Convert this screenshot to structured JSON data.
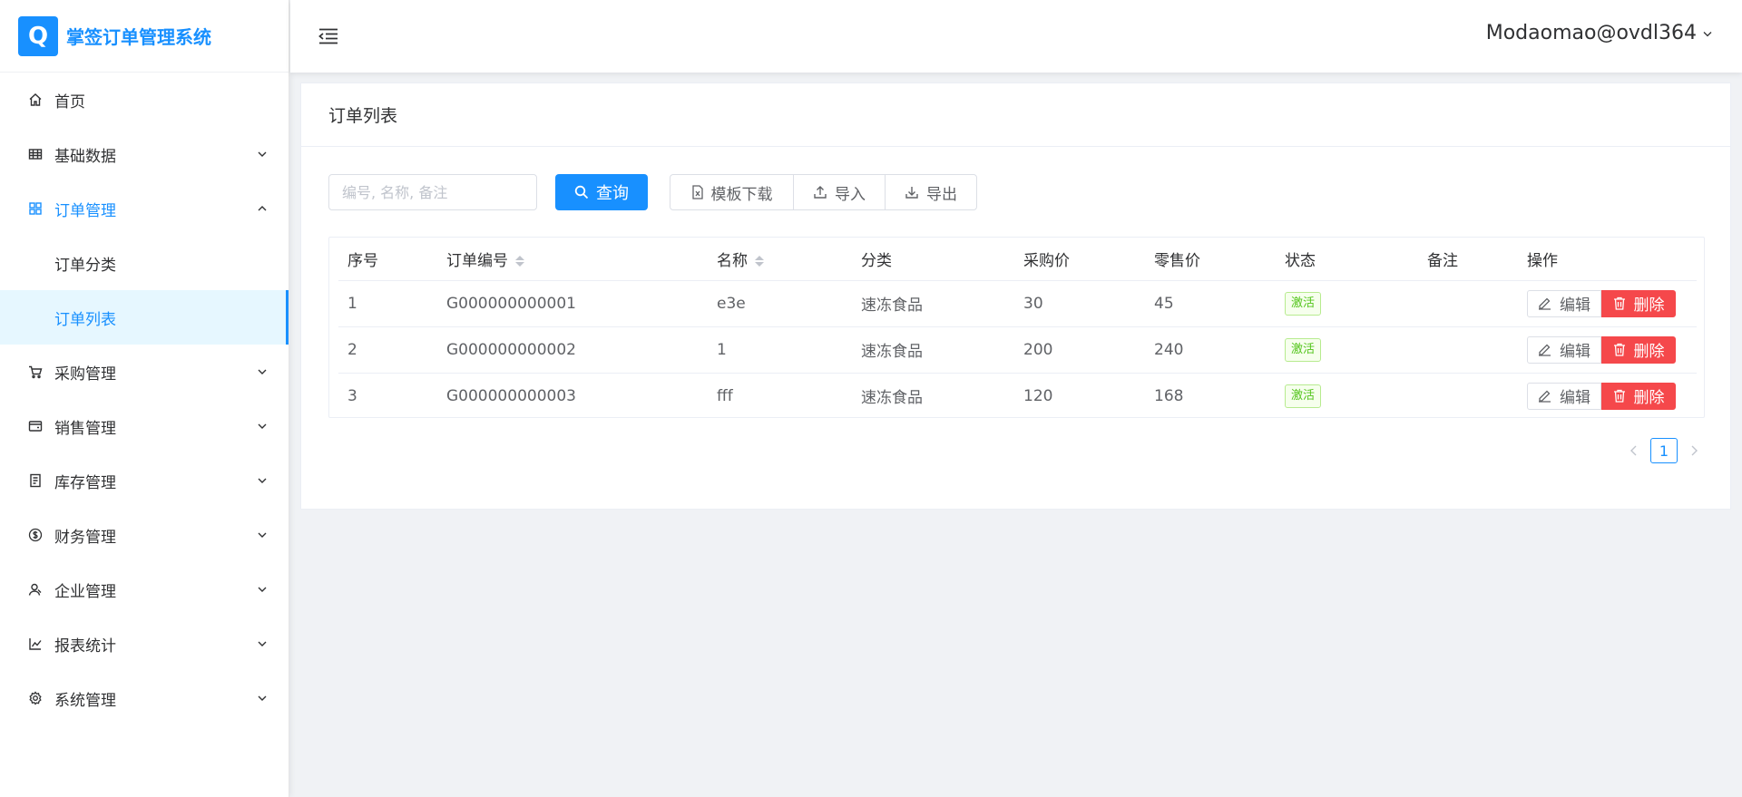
{
  "app": {
    "logo_glyph": "Q",
    "title": "掌签订单管理系统",
    "accent_color": "#1890ff"
  },
  "header": {
    "user": "Modaomao@ovdl364"
  },
  "sidebar": {
    "items": [
      {
        "label": "首页",
        "icon": "home-icon"
      },
      {
        "label": "基础数据",
        "icon": "table-icon"
      },
      {
        "label": "订单管理",
        "icon": "grid-icon",
        "expanded": true
      },
      {
        "label": "订单分类"
      },
      {
        "label": "订单列表",
        "active": true
      },
      {
        "label": "采购管理",
        "icon": "cart-icon"
      },
      {
        "label": "销售管理",
        "icon": "wallet-icon"
      },
      {
        "label": "库存管理",
        "icon": "document-icon"
      },
      {
        "label": "财务管理",
        "icon": "dollar-icon"
      },
      {
        "label": "企业管理",
        "icon": "user-icon"
      },
      {
        "label": "报表统计",
        "icon": "chart-icon"
      },
      {
        "label": "系统管理",
        "icon": "gear-icon"
      }
    ]
  },
  "card": {
    "title": "订单列表"
  },
  "toolbar": {
    "search_placeholder": "编号, 名称, 备注",
    "query_label": "查询",
    "template_label": "模板下载",
    "import_label": "导入",
    "export_label": "导出"
  },
  "table": {
    "columns": [
      "序号",
      "订单编号",
      "名称",
      "分类",
      "采购价",
      "零售价",
      "状态",
      "备注",
      "操作"
    ],
    "rows": [
      {
        "index": "1",
        "code": "G000000000001",
        "name": "e3e",
        "category": "速冻食品",
        "purchase": "30",
        "retail": "45",
        "status": "激活",
        "remark": ""
      },
      {
        "index": "2",
        "code": "G000000000002",
        "name": "1",
        "category": "速冻食品",
        "purchase": "200",
        "retail": "240",
        "status": "激活",
        "remark": ""
      },
      {
        "index": "3",
        "code": "G000000000003",
        "name": "fff",
        "category": "速冻食品",
        "purchase": "120",
        "retail": "168",
        "status": "激活",
        "remark": ""
      }
    ],
    "edit_label": "编辑",
    "delete_label": "删除",
    "status_color": "#52c41a",
    "delete_color": "#f5484b"
  },
  "pagination": {
    "current_page": "1"
  }
}
